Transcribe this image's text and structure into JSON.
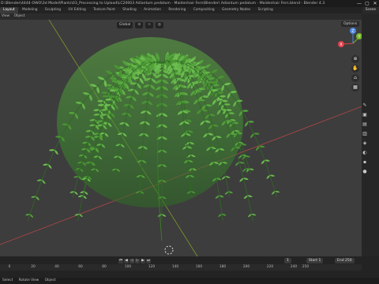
{
  "window": {
    "title": "D:\\Blender\\4444-OWO\\3d Model\\Plants\\03_Processing to Upload\\LC20003 Adiantum pedatum - Maidenhair Fern\\Blender\\ Adiantum pedatum - Maidenhair Fern.blend - Blender 4.3",
    "buttons": [
      "—",
      "▢",
      "✕"
    ]
  },
  "workspaces": {
    "tabs": [
      "Layout",
      "Modeling",
      "Sculpting",
      "UV Editing",
      "Texture Paint",
      "Shading",
      "Animation",
      "Rendering",
      "Compositing",
      "Geometry Nodes",
      "Scripting"
    ],
    "active": "Layout",
    "scene_label": "Scene"
  },
  "header": {
    "items": [
      "View",
      "Object"
    ],
    "global_label": "Global",
    "options_label": "Options"
  },
  "gizmo": {
    "x_label": "X",
    "y_label": "Y",
    "z_label": "Z",
    "colors": {
      "x": "#e0404a",
      "y": "#78b82a",
      "z": "#4e88e2"
    }
  },
  "timeline": {
    "current_frame": "1",
    "start_label": "Start",
    "start": "1",
    "end_label": "End",
    "end": "250",
    "ruler": [
      "0",
      "20",
      "40",
      "60",
      "80",
      "100",
      "120",
      "140",
      "160",
      "180",
      "200",
      "220",
      "240",
      "250"
    ]
  },
  "statusbar": {
    "items": [
      "Select",
      "Rotate View",
      "Object"
    ]
  },
  "colors": {
    "background": "#3d3d3d",
    "fern": "#4e9a3a",
    "grid_x": "#b44646",
    "grid_y": "#7a9a2a",
    "accent": "#4a72c4"
  }
}
